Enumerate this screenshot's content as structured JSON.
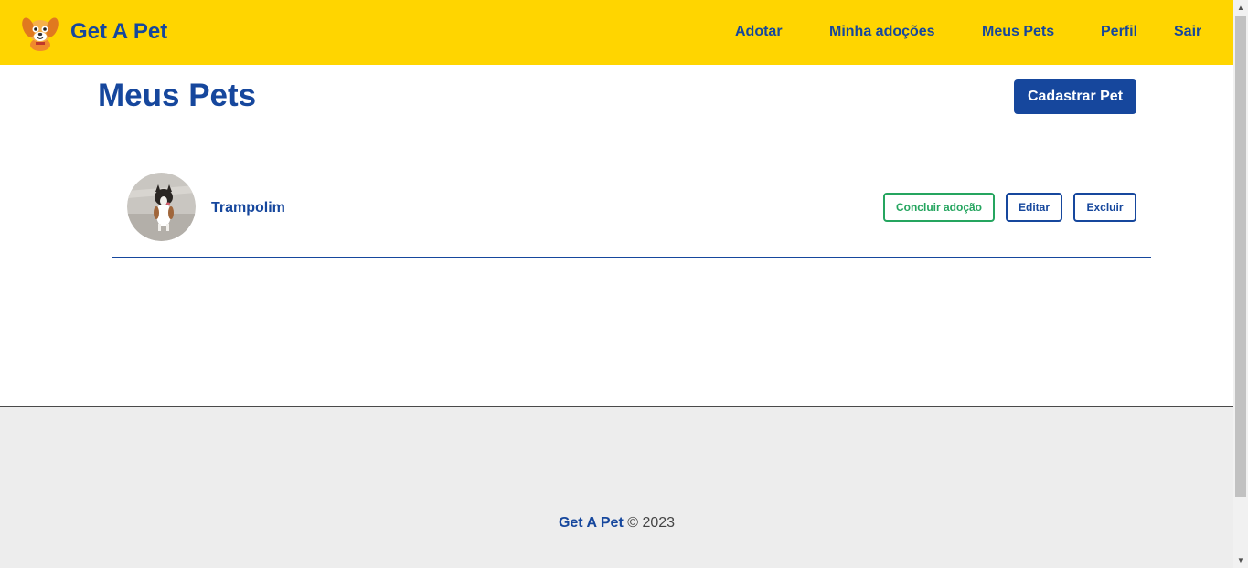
{
  "app": {
    "brand": "Get A Pet"
  },
  "nav": {
    "items": [
      {
        "label": "Adotar"
      },
      {
        "label": "Minha adoções"
      },
      {
        "label": "Meus Pets"
      },
      {
        "label": "Perfil"
      },
      {
        "label": "Sair"
      }
    ]
  },
  "main": {
    "title": "Meus Pets",
    "register_button": "Cadastrar Pet",
    "pets": [
      {
        "name": "Trampolim",
        "actions": {
          "conclude": "Concluir adoção",
          "edit": "Editar",
          "delete": "Excluir"
        }
      }
    ]
  },
  "footer": {
    "brand": "Get A Pet",
    "copyright": "© 2023"
  },
  "colors": {
    "navbar": "#ffd500",
    "primary": "#16479d",
    "success": "#25a55f",
    "footer_bg": "#ededed"
  },
  "icons": {
    "logo": "dog-logo-icon",
    "scroll_up": "arrow-up-icon",
    "scroll_down": "arrow-down-icon"
  }
}
